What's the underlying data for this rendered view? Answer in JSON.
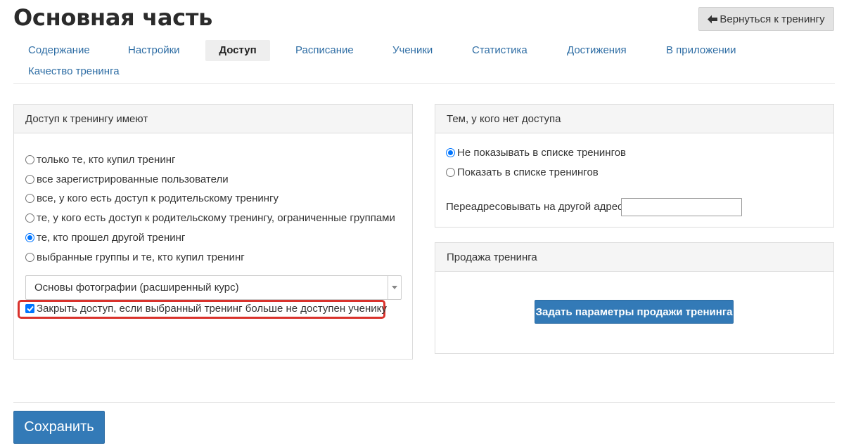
{
  "header": {
    "title": "Основная часть",
    "back_button_label": "Вернуться к тренингу",
    "back_icon": "arrow-left-icon"
  },
  "tabs": [
    {
      "label": "Содержание",
      "active": false
    },
    {
      "label": "Настройки",
      "active": false
    },
    {
      "label": "Доступ",
      "active": true
    },
    {
      "label": "Расписание",
      "active": false
    },
    {
      "label": "Ученики",
      "active": false
    },
    {
      "label": "Статистика",
      "active": false
    },
    {
      "label": "Достижения",
      "active": false
    },
    {
      "label": "В приложении",
      "active": false
    },
    {
      "label": "Качество тренинга",
      "active": false
    }
  ],
  "access_panel": {
    "heading": "Доступ к тренингу имеют",
    "options": [
      {
        "label": "только те, кто купил тренинг",
        "checked": false
      },
      {
        "label": "все зарегистрированные пользователи",
        "checked": false
      },
      {
        "label": "все, у кого есть доступ к родительскому тренингу",
        "checked": false
      },
      {
        "label": "те, у кого есть доступ к родительскому тренингу, ограниченные группами",
        "checked": false
      },
      {
        "label": "те, кто прошел другой тренинг",
        "checked": true
      },
      {
        "label": "выбранные группы и те, кто купил тренинг",
        "checked": false
      }
    ],
    "selected_training": "Основы фотографии (расширенный курс)",
    "close_access_label": "Закрыть доступ, если выбранный тренинг больше не доступен ученику",
    "close_access_checked": true,
    "highlight_color": "#d9322c"
  },
  "no_access_panel": {
    "heading": "Тем, у кого нет доступа",
    "options": [
      {
        "label": "Не показывать в списке тренингов",
        "checked": true
      },
      {
        "label": "Показать в списке тренингов",
        "checked": false
      }
    ],
    "redirect_label": "Переадресовывать на другой адрес",
    "redirect_value": ""
  },
  "sale_panel": {
    "heading": "Продажа тренинга",
    "button_label": "Задать параметры продажи тренинга"
  },
  "footer": {
    "save_label": "Сохранить"
  },
  "colors": {
    "primary": "#337ab7",
    "link": "#2e6da4",
    "radio_accent": "#0075ff"
  }
}
